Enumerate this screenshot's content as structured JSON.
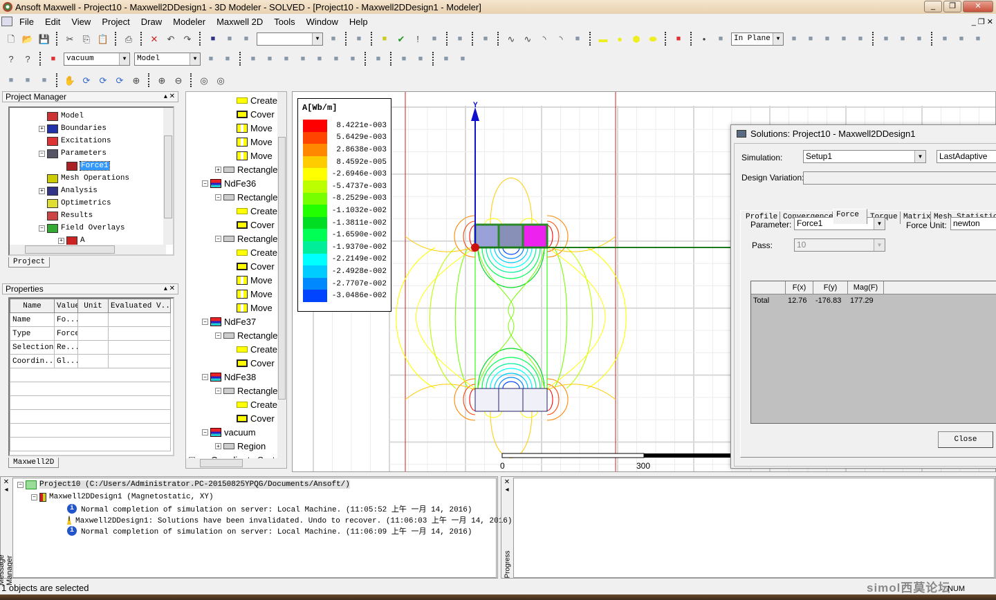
{
  "window": {
    "title": "Ansoft Maxwell  - Project10 - Maxwell2DDesign1 - 3D Modeler - SOLVED - [Project10 - Maxwell2DDesign1 - Modeler]",
    "controls": [
      "_",
      "❐",
      "✕"
    ]
  },
  "menu": [
    "File",
    "Edit",
    "View",
    "Project",
    "Draw",
    "Modeler",
    "Maxwell 2D",
    "Tools",
    "Window",
    "Help"
  ],
  "toolbar": {
    "row1a": [
      "new-icon",
      "open-icon",
      "save-icon",
      "|",
      "cut-icon",
      "copy-icon",
      "paste-icon",
      "|",
      "print-icon",
      "|",
      "delete-icon",
      "undo-icon",
      "redo-icon",
      "|",
      "select-icon",
      "pan-select-icon",
      "connect-icon"
    ],
    "row1_combo": "",
    "row1b": [
      "tree-icon",
      "|",
      "quickview-icon",
      "|",
      "validate-icon",
      "check-icon",
      "analyze-icon",
      "report-icon",
      "|",
      "fields-icon",
      "|",
      "solutions-icon",
      "|",
      "line-icon",
      "spline-icon",
      "arc-icon",
      "arc3-icon",
      "equation-curve-icon",
      "|",
      "rectangle-icon",
      "circle-icon",
      "polygon-icon",
      "ellipse-icon",
      "|",
      "region-icon",
      "|",
      "point-icon",
      "plane-icon"
    ],
    "plane_combo": "In Plane",
    "row1c": [
      "unite-icon",
      "subtract-icon",
      "intersect-icon",
      "split-icon",
      "imprint-icon",
      "|",
      "move-icon",
      "rotate-icon",
      "mirror-icon",
      "|",
      "duplicate-move-icon",
      "duplicate-rotate-icon",
      "duplicate-mirror-icon"
    ],
    "row2a": [
      "help-icon",
      "whats-this-icon",
      "|",
      "material-icon"
    ],
    "material_combo": "vacuum",
    "model_combo": "Model",
    "row2b": [
      "sweep-icon",
      "sheet-icon",
      "|",
      "axis-x-icon",
      "axis-y-icon",
      "axis-z-icon",
      "grid-icon",
      "snap-icon",
      "snap2-icon",
      "snap3-icon",
      "|",
      "view-icon",
      "|",
      "hide-icon",
      "hide-sel-icon",
      "|",
      "show-icon",
      "show-sel-icon"
    ],
    "row3": [
      "materials-icon",
      "objects-icon",
      "user-icon",
      "|",
      "pan-icon",
      "rotate-view-icon",
      "rotate-axis-icon",
      "spin-icon",
      "zoom-icon",
      "|",
      "zoom-in-icon",
      "zoom-out-icon",
      "|",
      "fit-all-icon",
      "fit-selection-icon"
    ]
  },
  "project_manager": {
    "title": "Project Manager",
    "items": [
      {
        "label": "Model",
        "level": 2,
        "exp": "",
        "color": "#c33"
      },
      {
        "label": "Boundaries",
        "level": 2,
        "exp": "+",
        "color": "#2233aa"
      },
      {
        "label": "Excitations",
        "level": 2,
        "exp": "",
        "color": "#d33"
      },
      {
        "label": "Parameters",
        "level": 2,
        "exp": "−",
        "color": "#556"
      },
      {
        "label": "Force1",
        "level": 3,
        "exp": "",
        "color": "#a22",
        "selected": true
      },
      {
        "label": "Mesh Operations",
        "level": 2,
        "exp": "",
        "color": "#cc0"
      },
      {
        "label": "Analysis",
        "level": 2,
        "exp": "+",
        "color": "#338"
      },
      {
        "label": "Optimetrics",
        "level": 2,
        "exp": "",
        "color": "#dd3"
      },
      {
        "label": "Results",
        "level": 2,
        "exp": "",
        "color": "#c44"
      },
      {
        "label": "Field Overlays",
        "level": 2,
        "exp": "−",
        "color": "#3a3"
      },
      {
        "label": "A",
        "level": 3,
        "exp": "+",
        "color": "#c22"
      }
    ],
    "tab": "Project"
  },
  "history_tree": [
    {
      "label": "Create",
      "level": 3,
      "type": "create"
    },
    {
      "label": "Cover",
      "level": 3,
      "type": "cover"
    },
    {
      "label": "Move",
      "level": 3,
      "type": "move"
    },
    {
      "label": "Move",
      "level": 3,
      "type": "move"
    },
    {
      "label": "Move",
      "level": 3,
      "type": "move"
    },
    {
      "label": "Rectangle",
      "level": 2,
      "type": "rect",
      "exp": "+"
    },
    {
      "label": "NdFe36",
      "level": 1,
      "type": "mat",
      "exp": "−"
    },
    {
      "label": "Rectangle",
      "level": 2,
      "type": "rect",
      "exp": "−"
    },
    {
      "label": "Create",
      "level": 3,
      "type": "create"
    },
    {
      "label": "Cover",
      "level": 3,
      "type": "cover"
    },
    {
      "label": "Rectangle",
      "level": 2,
      "type": "rect",
      "exp": "−"
    },
    {
      "label": "Create",
      "level": 3,
      "type": "create"
    },
    {
      "label": "Cover",
      "level": 3,
      "type": "cover"
    },
    {
      "label": "Move",
      "level": 3,
      "type": "move"
    },
    {
      "label": "Move",
      "level": 3,
      "type": "move"
    },
    {
      "label": "Move",
      "level": 3,
      "type": "move"
    },
    {
      "label": "NdFe37",
      "level": 1,
      "type": "mat",
      "exp": "−"
    },
    {
      "label": "Rectangle",
      "level": 2,
      "type": "rect",
      "exp": "−"
    },
    {
      "label": "Create",
      "level": 3,
      "type": "create"
    },
    {
      "label": "Cover",
      "level": 3,
      "type": "cover"
    },
    {
      "label": "NdFe38",
      "level": 1,
      "type": "mat",
      "exp": "−"
    },
    {
      "label": "Rectangle",
      "level": 2,
      "type": "rect",
      "exp": "−"
    },
    {
      "label": "Create",
      "level": 3,
      "type": "create"
    },
    {
      "label": "Cover",
      "level": 3,
      "type": "cover"
    },
    {
      "label": "vacuum",
      "level": 1,
      "type": "mat",
      "exp": "−"
    },
    {
      "label": "Region",
      "level": 2,
      "type": "rect",
      "exp": "+"
    },
    {
      "label": "Coordinate Syst",
      "level": 0,
      "type": "coord",
      "exp": "+"
    }
  ],
  "properties": {
    "title": "Properties",
    "columns": [
      "Name",
      "Value",
      "Unit",
      "Evaluated V..."
    ],
    "rows": [
      [
        "Name",
        "Fo...",
        "",
        ""
      ],
      [
        "Type",
        "Force",
        "",
        ""
      ],
      [
        "Selection",
        "Re...",
        "",
        ""
      ],
      [
        "Coordin...",
        "Gl...",
        "",
        ""
      ]
    ],
    "tab": "Maxwell2D"
  },
  "legend": {
    "title": "A[Wb/m]",
    "levels": [
      "8.4221e-003",
      "5.6429e-003",
      "2.8638e-003",
      "8.4592e-005",
      "-2.6946e-003",
      "-5.4737e-003",
      "-8.2529e-003",
      "-1.1032e-002",
      "-1.3811e-002",
      "-1.6590e-002",
      "-1.9370e-002",
      "-2.2149e-002",
      "-2.4928e-002",
      "-2.7707e-002",
      "-3.0486e-002"
    ],
    "colors": [
      "#ff0000",
      "#ff4400",
      "#ff8800",
      "#ffcc00",
      "#ffff00",
      "#bbff00",
      "#77ff00",
      "#22ff00",
      "#00dd22",
      "#00ff55",
      "#00ee99",
      "#00ffff",
      "#00ccff",
      "#0088ff",
      "#0044ff"
    ]
  },
  "viewport": {
    "axis_label": "Y",
    "scale_labels": [
      "0",
      "300"
    ]
  },
  "solutions_dialog": {
    "title": "Solutions: Project10 - Maxwell2DDesign1",
    "simulation_label": "Simulation:",
    "simulation": "Setup1",
    "solution": "LastAdaptive",
    "design_variation_label": "Design Variation:",
    "design_variation": "",
    "tabs": [
      "Profile",
      "Convergence",
      "Force",
      "Torque",
      "Matrix",
      "Mesh Statistics"
    ],
    "active_tab": "Force",
    "parameter_label": "Parameter:",
    "parameter": "Force1",
    "force_unit_label": "Force Unit:",
    "force_unit": "newton",
    "pass_label": "Pass:",
    "pass": "10",
    "columns": [
      "",
      "F(x)",
      "F(y)",
      "Mag(F)"
    ],
    "rows": [
      [
        "Total",
        "12.76",
        "-176.83",
        "177.29"
      ]
    ],
    "close": "Close"
  },
  "messages": {
    "panel_label": "Message Manager",
    "project": "Project10 (C:/Users/Administrator.PC-20150825YPQG/Documents/Ansoft/)",
    "design": "Maxwell2DDesign1 (Magnetostatic, XY)",
    "items": [
      {
        "type": "info",
        "text": "Normal completion of simulation on server: Local Machine. (11:05:52 上午  一月 14, 2016)"
      },
      {
        "type": "warning",
        "text": "Maxwell2DDesign1: Solutions have been invalidated. Undo to recover. (11:06:03 上午  一月 14, 2016)"
      },
      {
        "type": "info",
        "text": "Normal completion of simulation on server: Local Machine. (11:06:09 上午  一月 14, 2016)"
      }
    ]
  },
  "progress": {
    "label": "Progress"
  },
  "status": {
    "text": "1 objects are selected",
    "num": "NUM",
    "watermark": "simol西莫论坛"
  }
}
